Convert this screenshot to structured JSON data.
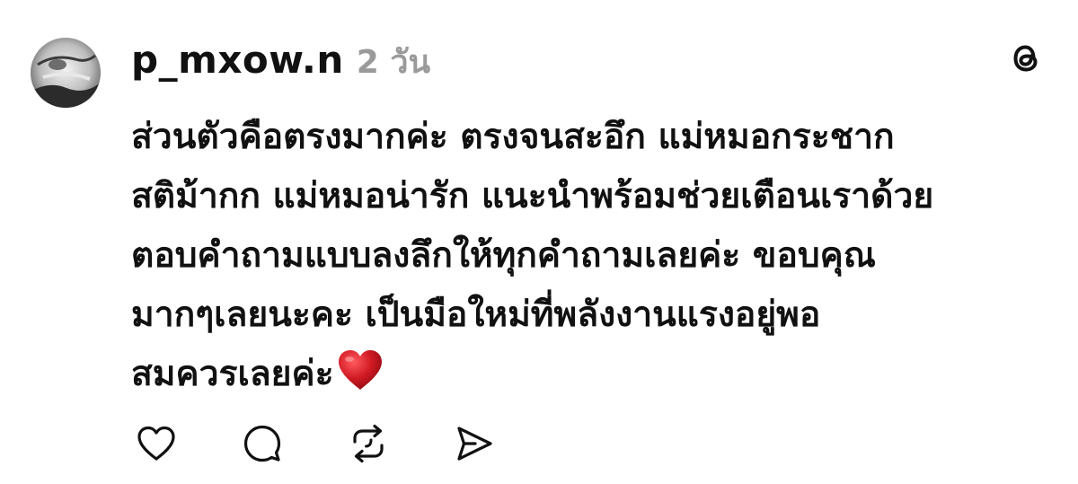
{
  "post": {
    "username": "p_mxow.n",
    "time": "2 วัน",
    "lines": [
      "ส่วนตัวคือตรงมากค่ะ ตรงจนสะอึก  แม่หมอกระชาก",
      "สติม้ากก แม่หมอน่ารัก แนะนำพร้อมช่วยเตือนเราด้วย",
      "ตอบคำถามแบบลงลึกให้ทุกคำถามเลยค่ะ ขอบคุณ",
      "มากๆเลยนะคะ เป็นมือใหม่ที่พลังงานแรงอยู่พอ",
      "สมควรเลยค่ะ"
    ],
    "emoji": "red-heart-emoji"
  },
  "icons": {
    "app_logo": "threads-logo-icon",
    "like": "heart-outline-icon",
    "comment": "comment-bubble-icon",
    "repost": "repost-icon",
    "share": "send-icon"
  },
  "colors": {
    "text": "#111111",
    "muted": "#9a9a9a",
    "heart": "#c1121f"
  }
}
